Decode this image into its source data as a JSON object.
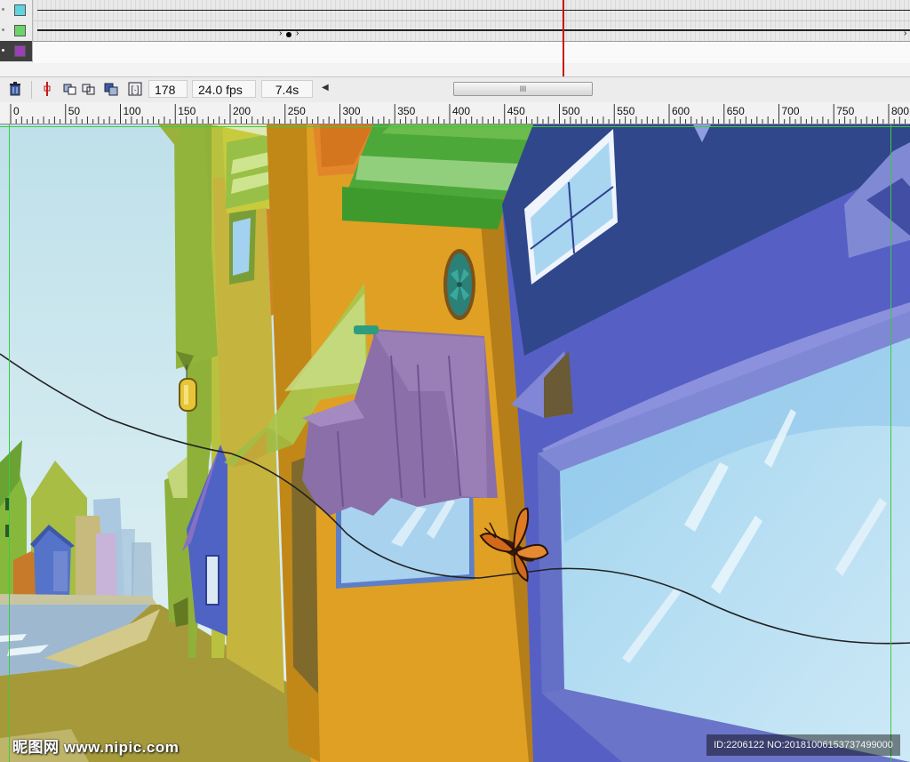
{
  "layers": [
    {
      "color": "#5fd3e0"
    },
    {
      "color": "#6ad46a"
    },
    {
      "color": "#9b3fb4"
    }
  ],
  "timeline_toolbar": {
    "frame": "178",
    "fps": "24.0 fps",
    "time": "7.4s",
    "scroll_grip": "III"
  },
  "ruler": {
    "labels": [
      "0",
      "50",
      "100",
      "150",
      "200",
      "250",
      "300",
      "350",
      "400",
      "450",
      "500",
      "550",
      "600",
      "650",
      "700",
      "750",
      "800"
    ]
  },
  "watermark": {
    "site": "昵图网 www.nipic.com",
    "id": "ID:2206122 NO:20181006153737499000"
  },
  "colors": {
    "playhead": "#c81616",
    "guide": "#3fc93f",
    "sky": "#cfe8ef"
  }
}
